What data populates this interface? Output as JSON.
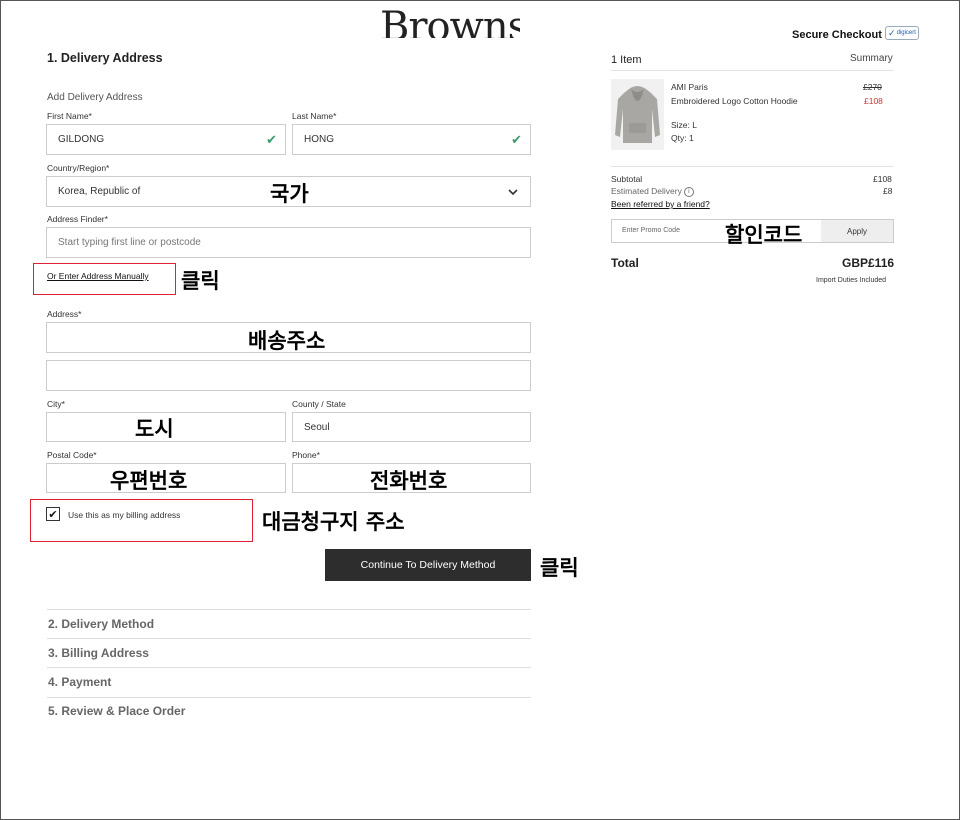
{
  "header": {
    "logo": "Browns",
    "secure_checkout": "Secure Checkout",
    "digicert": "digicert"
  },
  "delivery": {
    "section_title": "1. Delivery Address",
    "add_title": "Add Delivery Address",
    "first_name": {
      "label": "First Name*",
      "value": "GILDONG"
    },
    "last_name": {
      "label": "Last Name*",
      "value": "HONG"
    },
    "country": {
      "label": "Country/Region*",
      "value": "Korea, Republic of"
    },
    "address_finder": {
      "label": "Address Finder*",
      "placeholder": "Start typing first line or postcode"
    },
    "manual_link": "Or Enter Address Manually",
    "address": {
      "label": "Address*"
    },
    "city": {
      "label": "City*"
    },
    "county": {
      "label": "County / State",
      "value": "Seoul"
    },
    "postal": {
      "label": "Postal Code*"
    },
    "phone": {
      "label": "Phone*"
    },
    "billing_checkbox": {
      "label": "Use this as my billing address",
      "checked": true
    },
    "continue_button": "Continue To Delivery Method"
  },
  "steps": [
    "2. Delivery Method",
    "3. Billing Address",
    "4. Payment",
    "5. Review & Place Order"
  ],
  "summary": {
    "count": "1 Item",
    "summary_label": "Summary",
    "item": {
      "brand": "AMI Paris",
      "name": "Embroidered Logo Cotton Hoodie",
      "old_price": "£270",
      "price": "£108",
      "size": "Size: L",
      "qty": "Qty: 1"
    },
    "subtotal_label": "Subtotal",
    "subtotal_value": "£108",
    "delivery_label": "Estimated Delivery",
    "delivery_value": "£8",
    "referral": "Been referred by a friend?",
    "promo_placeholder": "Enter Promo Code",
    "apply": "Apply",
    "total_label": "Total",
    "total_value": "GBP£116",
    "duties": "Import Duties Included"
  },
  "annotations": {
    "country": "국가",
    "click1": "클릭",
    "address": "배송주소",
    "city": "도시",
    "postal": "우편번호",
    "phone": "전화번호",
    "billing": "대금청구지 주소",
    "click2": "클릭",
    "promo": "할인코드"
  },
  "colors": {
    "accent_red": "#d23333",
    "sale_red": "#d23333",
    "check_green": "#3a9a6a",
    "button_dark": "#2d2d2d"
  }
}
